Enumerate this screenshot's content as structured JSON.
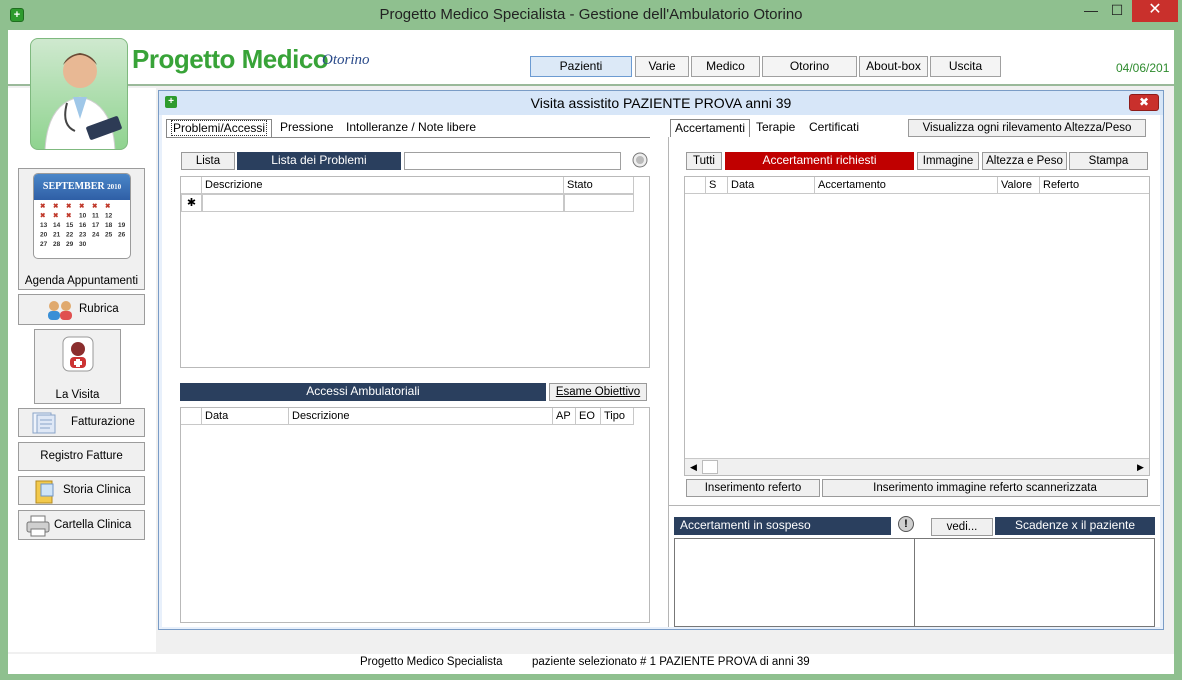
{
  "window": {
    "title": "Progetto Medico Specialista - Gestione dell'Ambulatorio Otorino",
    "minimize": "—",
    "maximize": "☐",
    "close": "✕"
  },
  "header": {
    "brand": "Progetto Medico",
    "brand_sub": "Otorino",
    "date": "04/06/201",
    "menu": [
      "Pazienti",
      "Varie",
      "Medico",
      "Otorino",
      "About-box",
      "Uscita"
    ]
  },
  "sidebar": {
    "calendar_month": "SEPTEMBER",
    "calendar_year": "2010",
    "calendar_rows": [
      [
        "✖",
        "✖",
        "✖",
        "✖",
        "✖",
        "✖"
      ],
      [
        "✖",
        "✖",
        "✖",
        "10",
        "11",
        "12"
      ],
      [
        "13",
        "14",
        "15",
        "16",
        "17",
        "18",
        "19"
      ],
      [
        "20",
        "21",
        "22",
        "23",
        "24",
        "25",
        "26"
      ],
      [
        "27",
        "28",
        "29",
        "30",
        "",
        "",
        ""
      ]
    ],
    "agenda": "Agenda Appuntamenti",
    "rubrica": "Rubrica",
    "visita": "La Visita",
    "fatturazione": "Fatturazione",
    "registro": "Registro Fatture",
    "storia": "Storia Clinica",
    "cartella": "Cartella Clinica"
  },
  "visit": {
    "title": "Visita assistito  PAZIENTE PROVA   anni 39",
    "close": "✖",
    "left_tabs": [
      "Problemi/Accessi",
      "Pressione",
      "Intolleranze / Note libere"
    ],
    "lista_btn": "Lista",
    "lista_problemi": "Lista dei Problemi",
    "problems_cols": [
      "Descrizione",
      "Stato"
    ],
    "new_row_marker": "✱",
    "accessi_title": "Accessi Ambulatoriali",
    "esame_btn": "Esame Obiettivo",
    "accessi_cols": [
      "Data",
      "Descrizione",
      "AP",
      "EO",
      "Tipo"
    ],
    "right_tabs": [
      "Accertamenti",
      "Terapie",
      "Certificati"
    ],
    "visualizza_btn": "Visualizza ogni rilevamento Altezza/Peso",
    "tutti_btn": "Tutti",
    "accertamenti_richiesti": "Accertamenti richiesti",
    "immagine_btn": "Immagine",
    "altezza_btn": "Altezza e Peso",
    "stampa_btn": "Stampa",
    "acc_cols": [
      "S",
      "Data",
      "Accertamento",
      "Valore",
      "Referto"
    ],
    "scroll_left": "◀",
    "scroll_right": "▶",
    "ins_referto": "Inserimento referto",
    "ins_immagine": "Inserimento immagine referto scannerizzata",
    "sospeso_title": "Accertamenti in sospeso",
    "vedi_btn": "vedi...",
    "scadenze_title": "Scadenze x il paziente",
    "info_glyph": "!"
  },
  "status": {
    "app": "Progetto Medico Specialista",
    "patient": "paziente selezionato  # 1   PAZIENTE  PROVA di anni 39"
  }
}
